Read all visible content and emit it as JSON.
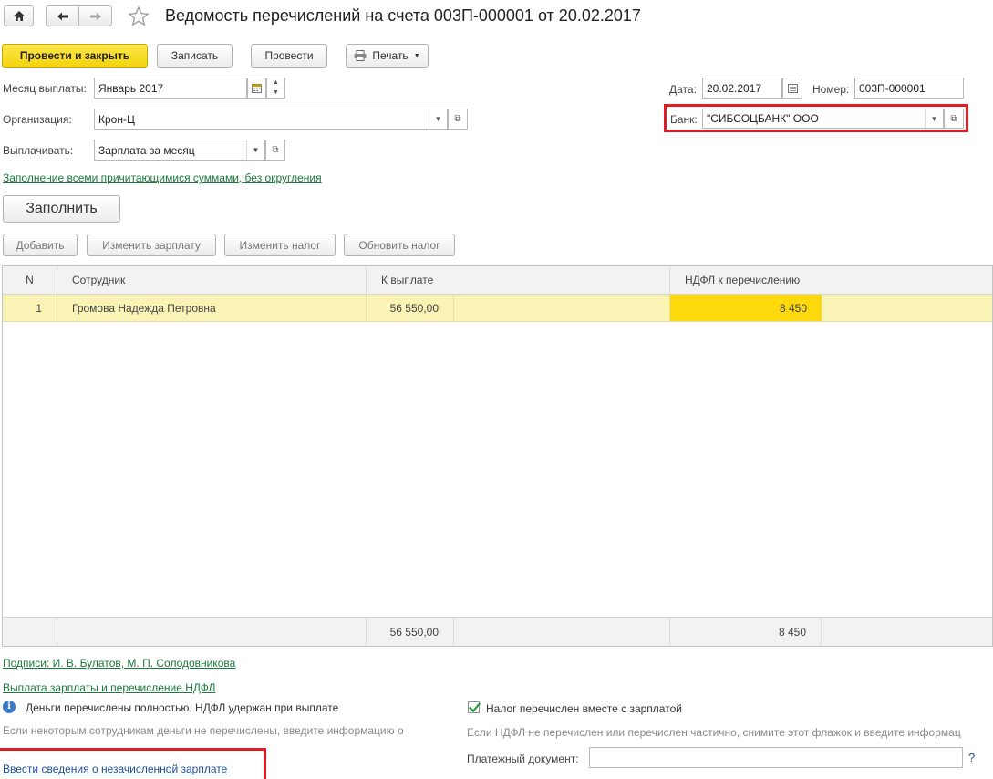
{
  "header": {
    "title": "Ведомость перечислений на счета 003П-000001 от 20.02.2017",
    "home_icon": "home-icon",
    "back_icon": "arrow-left-icon",
    "forward_icon": "arrow-right-icon",
    "star_icon": "star-icon"
  },
  "toolbar": {
    "post_close": "Провести и закрыть",
    "save": "Записать",
    "post": "Провести",
    "print": "Печать"
  },
  "form": {
    "month_label": "Месяц выплаты:",
    "month_value": "Январь 2017",
    "org_label": "Организация:",
    "org_value": "Крон-Ц",
    "pay_label": "Выплачивать:",
    "pay_value": "Зарплата за месяц",
    "date_label": "Дата:",
    "date_value": "20.02.2017",
    "number_label": "Номер:",
    "number_value": "003П-000001",
    "bank_label": "Банк:",
    "bank_value": "\"СИБСОЦБАНК\" ООО"
  },
  "fill_mode_link": "Заполнение всеми причитающимися суммами, без округления",
  "fill_button": "Заполнить",
  "table_toolbar": {
    "add": "Добавить",
    "change_salary": "Изменить зарплату",
    "change_tax": "Изменить налог",
    "update_tax": "Обновить налог"
  },
  "table": {
    "columns": [
      "N",
      "Сотрудник",
      "К выплате",
      "НДФЛ к перечислению"
    ],
    "rows": [
      {
        "n": "1",
        "employee": "Громова Надежда Петровна",
        "amount": "56 550,00",
        "ndfl": "8 450"
      }
    ],
    "totals": {
      "amount": "56 550,00",
      "ndfl": "8 450"
    }
  },
  "footer": {
    "signatures_link": "Подписи: И. В. Булатов, М. П. Солодовникова",
    "payment_link": "Выплата зарплаты и перечисление НДФЛ",
    "info_text": "Деньги перечислены  полностью, НДФЛ удержан при выплате",
    "info_hint": "Если некоторым сотрудникам деньги не перечислены, введите информацию о невыплаченных суммах",
    "unpaid_link": "Ввести сведения о незачисленной зарплате",
    "tax_checkbox_label": "Налог перечислен вместе с зарплатой",
    "tax_hint": "Если НДФЛ не перечислен или перечислен частично, снимите этот флажок и введите информац",
    "payment_doc_label": "Платежный документ:",
    "payment_doc_value": "",
    "help": "?"
  },
  "colors": {
    "accent_yellow": "#f4d40d",
    "row_highlight": "#faf3b6",
    "ndfl_cell": "#fbd90c",
    "link_green": "#1a7a3a",
    "link_blue": "#1c4f9c",
    "highlight_red": "#e01b24"
  }
}
